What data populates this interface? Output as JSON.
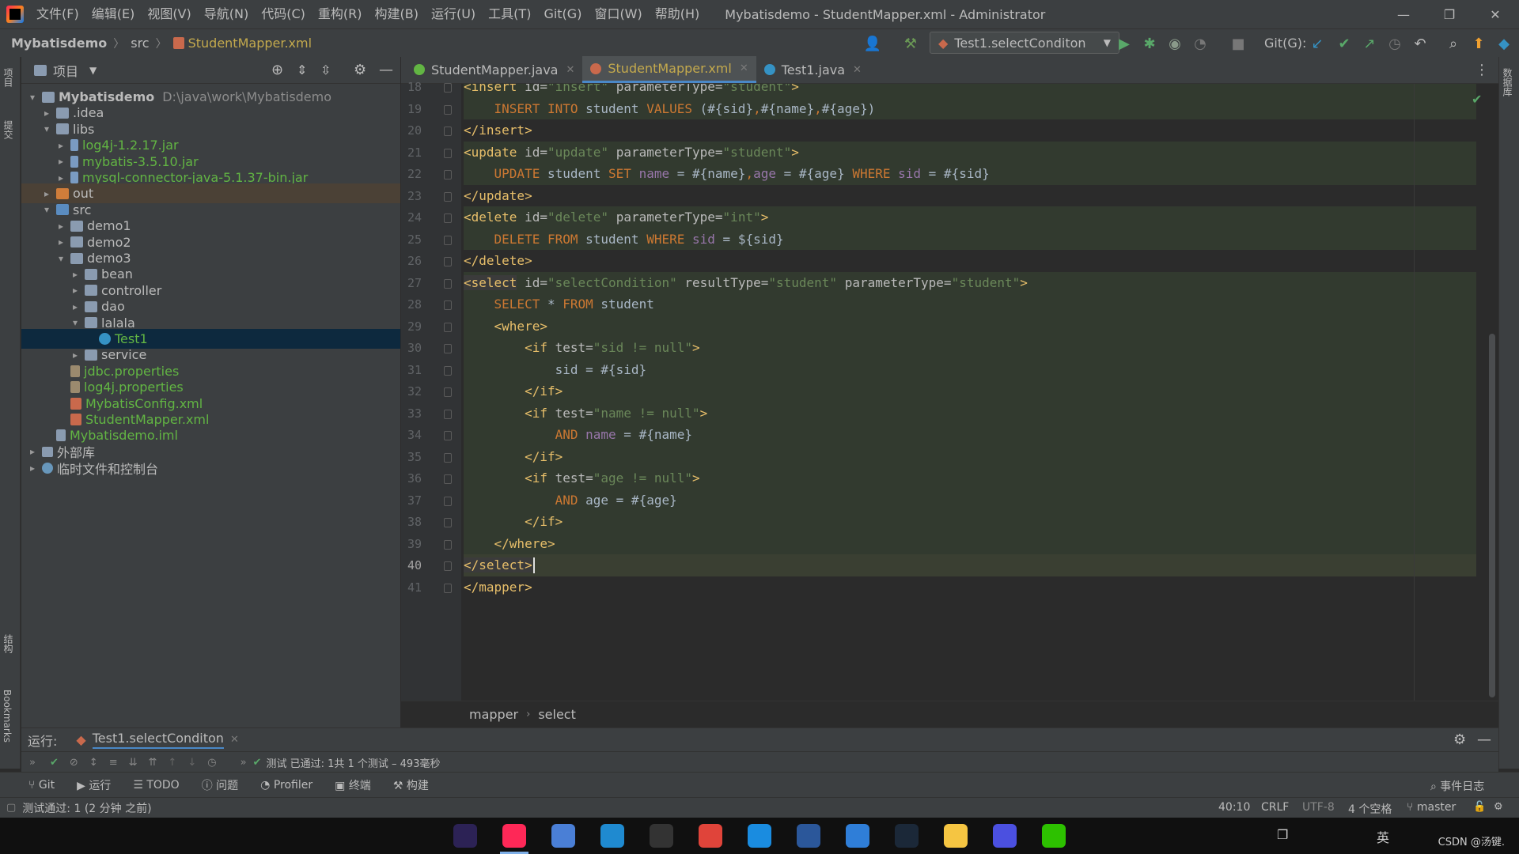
{
  "titlebar": {
    "menus": [
      "文件(F)",
      "编辑(E)",
      "视图(V)",
      "导航(N)",
      "代码(C)",
      "重构(R)",
      "构建(B)",
      "运行(U)",
      "工具(T)",
      "Git(G)",
      "窗口(W)",
      "帮助(H)"
    ],
    "window_title": "Mybatisdemo - StudentMapper.xml - Administrator",
    "minimize": "—",
    "restore": "❐",
    "close": "✕"
  },
  "navbar": {
    "crumbs": [
      "Mybatisdemo",
      "src",
      "StudentMapper.xml"
    ],
    "run_config": "Test1.selectConditon",
    "git_label": "Git(G):"
  },
  "project": {
    "header_label": "项目",
    "tree": [
      {
        "label": "Mybatisdemo",
        "path": "D:\\java\\work\\Mybatisdemo",
        "arrow": "▾",
        "icon": "module",
        "depth": 0,
        "style": "bold"
      },
      {
        "label": ".idea",
        "arrow": "▸",
        "icon": "folder",
        "depth": 1
      },
      {
        "label": "libs",
        "arrow": "▾",
        "icon": "folder",
        "depth": 1
      },
      {
        "label": "log4j-1.2.17.jar",
        "arrow": "▸",
        "icon": "jar",
        "depth": 2,
        "style": "green"
      },
      {
        "label": "mybatis-3.5.10.jar",
        "arrow": "▸",
        "icon": "jar",
        "depth": 2,
        "style": "green"
      },
      {
        "label": "mysql-connector-java-5.1.37-bin.jar",
        "arrow": "▸",
        "icon": "jar",
        "depth": 2,
        "style": "green"
      },
      {
        "label": "out",
        "arrow": "▸",
        "icon": "folder-orange",
        "depth": 1,
        "row": "hl-out"
      },
      {
        "label": "src",
        "arrow": "▾",
        "icon": "folder-blue",
        "depth": 1
      },
      {
        "label": "demo1",
        "arrow": "▸",
        "icon": "folder",
        "depth": 2
      },
      {
        "label": "demo2",
        "arrow": "▸",
        "icon": "folder",
        "depth": 2
      },
      {
        "label": "demo3",
        "arrow": "▾",
        "icon": "folder",
        "depth": 2
      },
      {
        "label": "bean",
        "arrow": "▸",
        "icon": "folder",
        "depth": 3
      },
      {
        "label": "controller",
        "arrow": "▸",
        "icon": "folder",
        "depth": 3
      },
      {
        "label": "dao",
        "arrow": "▸",
        "icon": "folder",
        "depth": 3
      },
      {
        "label": "lalala",
        "arrow": "▾",
        "icon": "folder",
        "depth": 3
      },
      {
        "label": "Test1",
        "arrow": "",
        "icon": "class",
        "depth": 4,
        "style": "green",
        "row": "selected"
      },
      {
        "label": "service",
        "arrow": "▸",
        "icon": "folder",
        "depth": 3
      },
      {
        "label": "jdbc.properties",
        "arrow": "",
        "icon": "props",
        "depth": 2,
        "style": "green"
      },
      {
        "label": "log4j.properties",
        "arrow": "",
        "icon": "props",
        "depth": 2,
        "style": "green"
      },
      {
        "label": "MybatisConfig.xml",
        "arrow": "",
        "icon": "xml",
        "depth": 2,
        "style": "green"
      },
      {
        "label": "StudentMapper.xml",
        "arrow": "",
        "icon": "xml",
        "depth": 2,
        "style": "green"
      },
      {
        "label": "Mybatisdemo.iml",
        "arrow": "",
        "icon": "iml",
        "depth": 1,
        "style": "green"
      },
      {
        "label": "外部库",
        "arrow": "▸",
        "icon": "lib",
        "depth": 0
      },
      {
        "label": "临时文件和控制台",
        "arrow": "▸",
        "icon": "scratch",
        "depth": 0
      }
    ]
  },
  "editor": {
    "tabs": [
      {
        "label": "StudentMapper.java",
        "icon_color": "#62b543",
        "active": false
      },
      {
        "label": "StudentMapper.xml",
        "icon_color": "#c9694c",
        "active": true
      },
      {
        "label": "Test1.java",
        "icon_color": "#3592c4",
        "active": false
      }
    ],
    "lines": [
      {
        "n": "18",
        "html": "<span class='t'>&lt;insert</span> <span class='a'>id=</span><span class='v'>\"insert\"</span> <span class='a'>parameterType=</span><span class='v'>\"student\"</span><span class='t'>&gt;</span>",
        "hl": true
      },
      {
        "n": "19",
        "html": "    <span class='k'>INSERT INTO</span> student <span class='k'>VALUES</span> (#{sid}<span class='k'>,</span>#{name}<span class='k'>,</span>#{age})",
        "hl": true
      },
      {
        "n": "20",
        "html": "<span class='t'>&lt;/insert&gt;</span>",
        "hl": false
      },
      {
        "n": "21",
        "html": "<span class='t'>&lt;update</span> <span class='a'>id=</span><span class='v'>\"update\"</span> <span class='a'>parameterType=</span><span class='v'>\"student\"</span><span class='t'>&gt;</span>",
        "hl": true
      },
      {
        "n": "22",
        "html": "    <span class='k'>UPDATE</span> student <span class='k'>SET</span> <span class='f'>name</span> = #{name}<span class='k'>,</span><span class='f'>age</span> = #{age} <span class='k'>WHERE</span> <span class='f'>sid</span> = #{sid}",
        "hl": true
      },
      {
        "n": "23",
        "html": "<span class='t'>&lt;/update&gt;</span>",
        "hl": false
      },
      {
        "n": "24",
        "html": "<span class='t'>&lt;delete</span> <span class='a'>id=</span><span class='v'>\"delete\"</span> <span class='a'>parameterType=</span><span class='v'>\"int\"</span><span class='t'>&gt;</span>",
        "hl": true
      },
      {
        "n": "25",
        "html": "    <span class='k'>DELETE FROM</span> student <span class='k'>WHERE</span> <span class='f'>sid</span> = ${sid}",
        "hl": true
      },
      {
        "n": "26",
        "html": "<span class='t'>&lt;/delete&gt;</span>",
        "hl": false
      },
      {
        "n": "27",
        "html": "<span class='t tagbg'>&lt;select</span> <span class='a'>id=</span><span class='v'>\"selectCondition\"</span> <span class='a'>resultType=</span><span class='v'>\"student\"</span> <span class='a'>parameterType=</span><span class='v'>\"student\"</span><span class='t'>&gt;</span>",
        "hl": true
      },
      {
        "n": "28",
        "html": "    <span class='k'>SELECT</span> * <span class='k'>FROM</span> student",
        "hl": true
      },
      {
        "n": "29",
        "html": "    <span class='t'>&lt;where&gt;</span>",
        "hl": true
      },
      {
        "n": "30",
        "html": "        <span class='t'>&lt;if</span> <span class='a'>test=</span><span class='v'>\"sid != null\"</span><span class='t'>&gt;</span>",
        "hl": true
      },
      {
        "n": "31",
        "html": "            sid = #{sid}",
        "hl": true
      },
      {
        "n": "32",
        "html": "        <span class='t'>&lt;/if&gt;</span>",
        "hl": true
      },
      {
        "n": "33",
        "html": "        <span class='t'>&lt;if</span> <span class='a'>test=</span><span class='v'>\"name != null\"</span><span class='t'>&gt;</span>",
        "hl": true
      },
      {
        "n": "34",
        "html": "            <span class='k'>AND</span> <span class='f'>name</span> = #{name}",
        "hl": true
      },
      {
        "n": "35",
        "html": "        <span class='t'>&lt;/if&gt;</span>",
        "hl": true
      },
      {
        "n": "36",
        "html": "        <span class='t'>&lt;if</span> <span class='a'>test=</span><span class='v'>\"age != null\"</span><span class='t'>&gt;</span>",
        "hl": true
      },
      {
        "n": "37",
        "html": "            <span class='k'>AND</span> age = #{age}",
        "hl": true
      },
      {
        "n": "38",
        "html": "        <span class='t'>&lt;/if&gt;</span>",
        "hl": true
      },
      {
        "n": "39",
        "html": "    <span class='t'>&lt;/where&gt;</span>",
        "hl": true
      },
      {
        "n": "40",
        "html": "<span class='t tagbg'>&lt;/select&gt;</span>",
        "hl": true,
        "current": true
      },
      {
        "n": "41",
        "html": "<span class='t'>&lt;/mapper&gt;</span>",
        "hl": false
      }
    ],
    "breadcrumb": [
      "mapper",
      "select"
    ]
  },
  "run_panel": {
    "label": "运行:",
    "config_tab": "Test1.selectConditon",
    "result": "测试 已通过: 1共 1 个测试 – 493毫秒"
  },
  "bottom_tools": [
    "Git",
    "运行",
    "TODO",
    "问题",
    "Profiler",
    "终端",
    "构建"
  ],
  "event_log": "事件日志",
  "status": {
    "message": "测试通过: 1 (2 分钟 之前)",
    "position": "40:10",
    "line_sep": "CRLF",
    "encoding": "UTF-8",
    "indent": "4 个空格",
    "branch": "master"
  },
  "side_labels": {
    "left_top": "项目",
    "left_mid": "提交",
    "left_struct": "结构",
    "left_bookmarks": "Bookmarks",
    "right_db": "数据库"
  },
  "taskbar": {
    "apps": [
      {
        "name": "eclipse",
        "color": "#2c2255"
      },
      {
        "name": "intellij",
        "color": "#fe2857",
        "active": true
      },
      {
        "name": "chromium",
        "color": "#4a7fd6"
      },
      {
        "name": "vmware",
        "color": "#1f8ad0"
      },
      {
        "name": "terminal",
        "color": "#333333"
      },
      {
        "name": "chrome",
        "color": "#e0443a"
      },
      {
        "name": "vscode",
        "color": "#1a8ce0"
      },
      {
        "name": "word",
        "color": "#2b579a"
      },
      {
        "name": "todo",
        "color": "#2f7ed8"
      },
      {
        "name": "steam",
        "color": "#1b2838"
      },
      {
        "name": "explorer",
        "color": "#f5c542"
      },
      {
        "name": "player",
        "color": "#4b50e0"
      },
      {
        "name": "wechat",
        "color": "#2dc100"
      }
    ],
    "watermark": "CSDN @汤键."
  }
}
